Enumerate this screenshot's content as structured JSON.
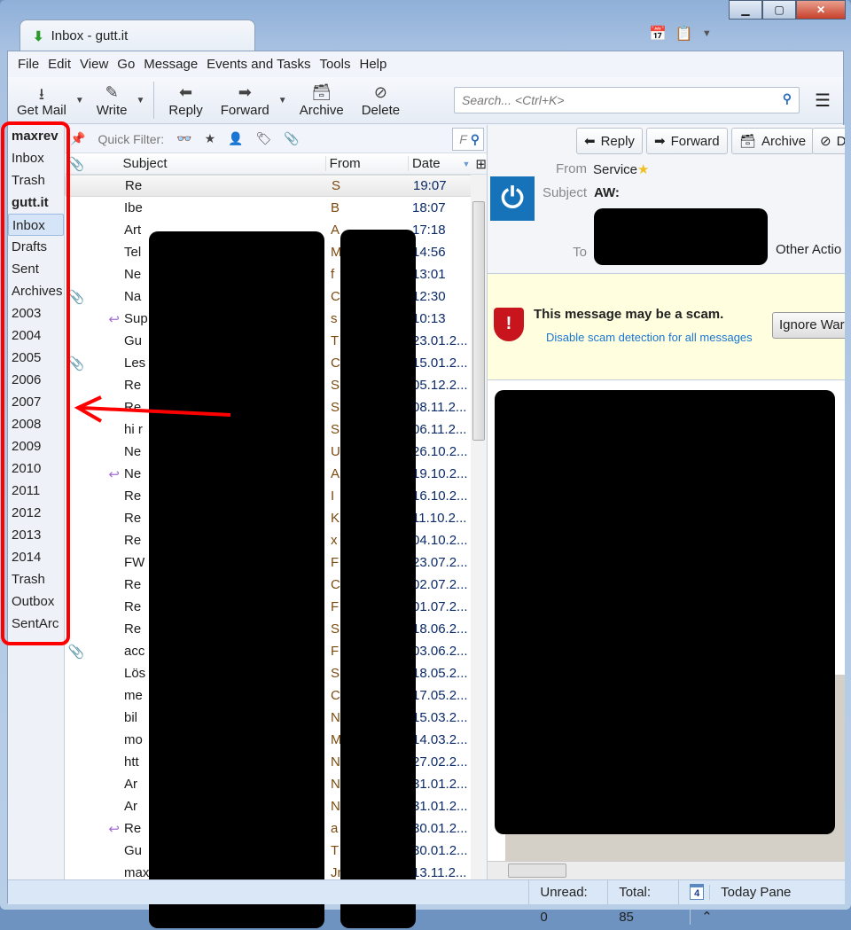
{
  "window": {
    "tab_title": "Inbox - gutt.it",
    "controls": [
      "minimize",
      "maximize",
      "close"
    ]
  },
  "menu": [
    "File",
    "Edit",
    "View",
    "Go",
    "Message",
    "Events and Tasks",
    "Tools",
    "Help"
  ],
  "toolbar": {
    "get_mail": "Get Mail",
    "write": "Write",
    "reply": "Reply",
    "forward": "Forward",
    "archive": "Archive",
    "delete": "Delete",
    "search_placeholder": "Search... <Ctrl+K>"
  },
  "folders": [
    {
      "label": "maxrev",
      "account": true
    },
    {
      "label": "Inbox"
    },
    {
      "label": "Trash"
    },
    {
      "label": "gutt.it",
      "account": true
    },
    {
      "label": "Inbox",
      "selected": true
    },
    {
      "label": "Drafts"
    },
    {
      "label": "Sent"
    },
    {
      "label": "Archives"
    },
    {
      "label": "2003"
    },
    {
      "label": "2004"
    },
    {
      "label": "2005"
    },
    {
      "label": "2006"
    },
    {
      "label": "2007"
    },
    {
      "label": "2008"
    },
    {
      "label": "2009"
    },
    {
      "label": "2010"
    },
    {
      "label": "2011"
    },
    {
      "label": "2012"
    },
    {
      "label": "2013"
    },
    {
      "label": "2014"
    },
    {
      "label": "Trash"
    },
    {
      "label": "Outbox"
    },
    {
      "label": "SentArc"
    }
  ],
  "quick_filter": {
    "label": "Quick Filter:",
    "filter_input": "F"
  },
  "columns": {
    "subject": "Subject",
    "from": "From",
    "date": "Date"
  },
  "messages": [
    {
      "subject": "Re",
      "from": "S",
      "date": "19:07",
      "selected": true
    },
    {
      "subject": "Ibe",
      "from": "B",
      "date": "18:07"
    },
    {
      "subject": "Art",
      "from": "A",
      "date": "17:18"
    },
    {
      "subject": "Tel",
      "from": "M",
      "date": "14:56"
    },
    {
      "subject": "Ne",
      "from": "f",
      "date": "13:01"
    },
    {
      "subject": "Na",
      "from": "C",
      "date": "12:30",
      "attachment": true
    },
    {
      "subject": "Sup",
      "from": "s",
      "date": "10:13",
      "replied": true
    },
    {
      "subject": "Gu",
      "from": "T",
      "date": "23.01.2..."
    },
    {
      "subject": "Les",
      "from": "C",
      "date": "15.01.2...",
      "attachment": true
    },
    {
      "subject": "Re",
      "from": "S",
      "date": "05.12.2..."
    },
    {
      "subject": "Re",
      "from": "S",
      "date": "08.11.2..."
    },
    {
      "subject": "hi r",
      "from": "S",
      "date": "06.11.2..."
    },
    {
      "subject": "Ne",
      "from": "U",
      "date": "26.10.2..."
    },
    {
      "subject": "Ne",
      "from": "A",
      "date": "19.10.2...",
      "replied": true
    },
    {
      "subject": "Re",
      "from": "I",
      "date": "16.10.2..."
    },
    {
      "subject": "Re",
      "from": "K",
      "date": "11.10.2..."
    },
    {
      "subject": "Re",
      "from": "x",
      "date": "04.10.2..."
    },
    {
      "subject": "FW",
      "from": "F",
      "date": "23.07.2..."
    },
    {
      "subject": "Re",
      "from": "C",
      "date": "02.07.2..."
    },
    {
      "subject": "Re",
      "from": "F",
      "date": "01.07.2..."
    },
    {
      "subject": "Re",
      "from": "S",
      "date": "18.06.2..."
    },
    {
      "subject": "acc",
      "from": "F",
      "date": "03.06.2...",
      "attachment": true
    },
    {
      "subject": "Lös",
      "from": "S",
      "date": "18.05.2..."
    },
    {
      "subject": "me",
      "from": "C",
      "date": "17.05.2..."
    },
    {
      "subject": "bil",
      "from": "N",
      "date": "15.03.2..."
    },
    {
      "subject": "mo",
      "from": "M",
      "date": "14.03.2..."
    },
    {
      "subject": "htt",
      "from": "N",
      "date": "27.02.2..."
    },
    {
      "subject": "Ar",
      "from": "N",
      "date": "31.01.2..."
    },
    {
      "subject": "Ar",
      "from": "N",
      "date": "31.01.2..."
    },
    {
      "subject": "Re",
      "from": "a",
      "date": "30.01.2...",
      "replied": true
    },
    {
      "subject": "Gu",
      "from": "T",
      "date": "30.01.2..."
    },
    {
      "subject": "maxn.v.ut",
      "from": "Jmnk...",
      "date": "13.11.2..."
    }
  ],
  "preview": {
    "buttons": {
      "reply": "Reply",
      "forward": "Forward",
      "archive": "Archive",
      "delete": "D"
    },
    "from_label": "From",
    "from": "Service",
    "subject_label": "Subject",
    "subject": "AW:",
    "to_label": "To",
    "other_actions": "Other Actio",
    "scam_title": "This message may be a scam.",
    "scam_link": "Disable scam detection for all messages",
    "ignore_button": "Ignore Warn"
  },
  "status": {
    "unread": "Unread: 0",
    "total": "Total: 85",
    "today_pane": "Today Pane",
    "calendar_day": "4"
  },
  "colors": {
    "annotation": "#ff0000",
    "link": "#1a76d2",
    "scam_bg": "#ffffe0"
  }
}
